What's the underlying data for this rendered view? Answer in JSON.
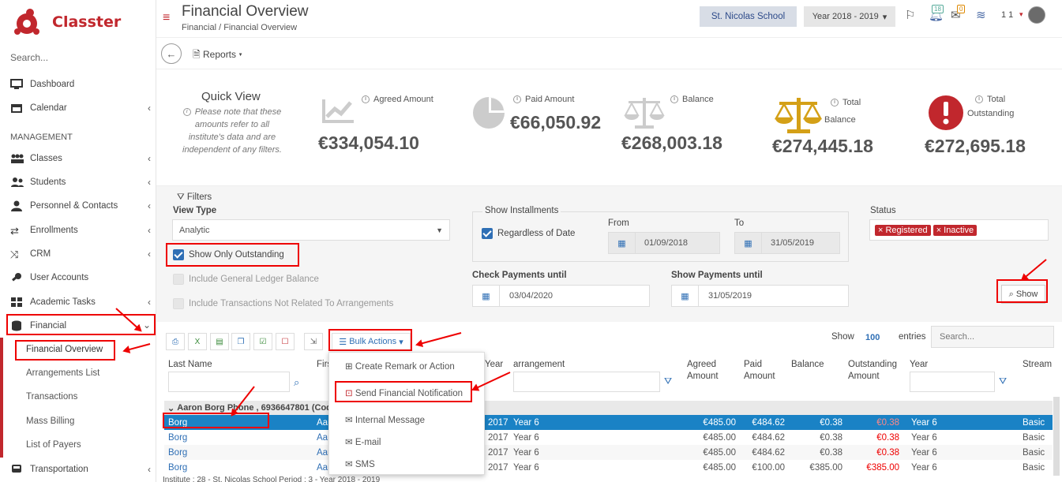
{
  "app": {
    "name": "Classter"
  },
  "sidebar": {
    "search_label": "Search...",
    "items": [
      {
        "label": "Dashboard"
      },
      {
        "label": "Calendar"
      },
      {
        "label": "Classes"
      },
      {
        "label": "Students"
      },
      {
        "label": "Personnel & Contacts"
      },
      {
        "label": "Enrollments"
      },
      {
        "label": "CRM"
      },
      {
        "label": "User Accounts"
      },
      {
        "label": "Academic Tasks"
      },
      {
        "label": "Financial"
      },
      {
        "label": "Transportation"
      }
    ],
    "section": "MANAGEMENT",
    "financial_sub": [
      "Financial Overview",
      "Arrangements List",
      "Transactions",
      "Mass Billing",
      "List of Payers"
    ]
  },
  "header": {
    "title": "Financial Overview",
    "breadcrumb": "Financial  /  Financial Overview",
    "school": "St. Nicolas School",
    "year": "Year 2018 - 2019",
    "badge_1": "18",
    "badge_2": "0",
    "user_count": "1 1"
  },
  "toolbar": {
    "reports": "Reports"
  },
  "quick_view": {
    "title": "Quick View",
    "note": "Please note that these amounts refer to all institute's data and are independent of any filters.",
    "stats": [
      {
        "label": "Agreed Amount",
        "value": "€334,054.10"
      },
      {
        "label": "Paid Amount",
        "value": "€66,050.92"
      },
      {
        "label": "Balance",
        "value": "€268,003.18"
      },
      {
        "label": "Total",
        "label2": "Balance",
        "value": "€274,445.18"
      },
      {
        "label": "Total",
        "label2": "Outstanding",
        "value": "€272,695.18"
      }
    ]
  },
  "filters": {
    "title": "Filters",
    "view_type_label": "View Type",
    "view_type_value": "Analytic",
    "show_only_outstanding": "Show Only Outstanding",
    "include_gl": "Include General Ledger Balance",
    "include_tx": "Include Transactions Not Related To Arrangements",
    "show_installments": "Show Installments",
    "regardless": "Regardless of Date",
    "from_label": "From",
    "from_value": "01/09/2018",
    "to_label": "To",
    "to_value": "31/05/2019",
    "status_label": "Status",
    "status_tags": [
      "Registered",
      "Inactive"
    ],
    "check_payments_label": "Check Payments until",
    "check_payments_value": "03/04/2020",
    "show_payments_label": "Show Payments until",
    "show_payments_value": "31/05/2019",
    "show_button": "Show"
  },
  "table": {
    "bulk_actions": "Bulk Actions",
    "show_label": "Show",
    "entries_count": "100",
    "entries_label": "entries",
    "search_placeholder": "Search...",
    "headers": {
      "last_name": "Last Name",
      "first": "Firs",
      "year_col": "Year",
      "arrangement": "arrangement",
      "agreed": "Agreed",
      "agreed2": "Amount",
      "paid": "Paid",
      "paid2": "Amount",
      "balance": "Balance",
      "outstanding": "Outstanding",
      "outstanding2": "Amount",
      "year": "Year",
      "stream": "Stream"
    },
    "group": "Aaron Borg Phone , 6936647801 (Code",
    "rows": [
      {
        "last": "Borg",
        "first": "Aar",
        "yr": "2017",
        "arr": "Year 6",
        "agreed": "€485.00",
        "paid": "€484.62",
        "balance": "€0.38",
        "out": "€0.38",
        "year": "Year 6",
        "stream": "Basic"
      },
      {
        "last": "Borg",
        "first": "Aar",
        "yr": "2017",
        "arr": "Year 6",
        "agreed": "€485.00",
        "paid": "€484.62",
        "balance": "€0.38",
        "out": "€0.38",
        "year": "Year 6",
        "stream": "Basic"
      },
      {
        "last": "Borg",
        "first": "Aar",
        "yr": "2017",
        "arr": "Year 6",
        "agreed": "€485.00",
        "paid": "€484.62",
        "balance": "€0.38",
        "out": "€0.38",
        "year": "Year 6",
        "stream": "Basic"
      },
      {
        "last": "Borg",
        "first": "Aar",
        "yr": "2017",
        "arr": "Year 6",
        "agreed": "€485.00",
        "paid": "€100.00",
        "balance": "€385.00",
        "out": "€385.00",
        "year": "Year 6",
        "stream": "Basic"
      }
    ]
  },
  "bulk_menu": [
    "Create Remark or Action",
    "Send Financial Notification",
    "Internal Message",
    "E-mail",
    "SMS"
  ],
  "footer": "Institute : 28 - St. Nicolas School Period : 3 - Year 2018 - 2019",
  "colors": {
    "brand": "#c1272d",
    "accent": "#2f6fb5",
    "selected_row": "#1a82c5",
    "gold": "#d4a017"
  }
}
